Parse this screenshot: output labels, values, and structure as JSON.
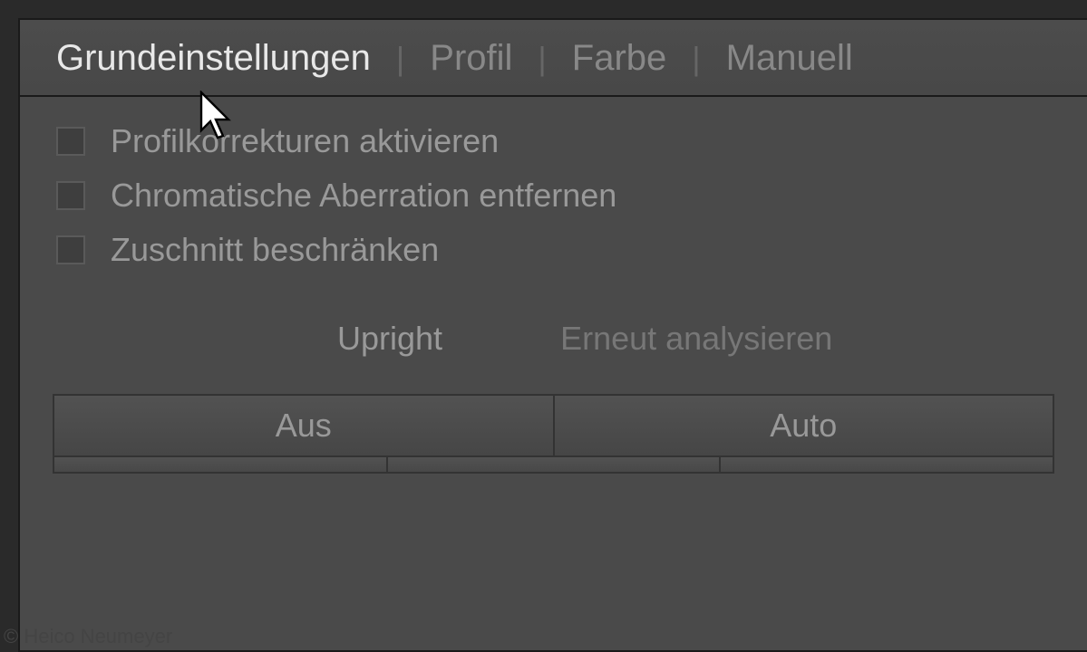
{
  "tabs": {
    "items": [
      {
        "label": "Grundeinstellungen",
        "active": true
      },
      {
        "label": "Profil",
        "active": false
      },
      {
        "label": "Farbe",
        "active": false
      },
      {
        "label": "Manuell",
        "active": false
      }
    ]
  },
  "checkboxes": {
    "items": [
      {
        "label": "Profilkorrekturen aktivieren",
        "checked": false
      },
      {
        "label": "Chromatische Aberration entfernen",
        "checked": false
      },
      {
        "label": "Zuschnitt beschränken",
        "checked": false
      }
    ]
  },
  "upright": {
    "label": "Upright",
    "reanalyze": "Erneut analysieren"
  },
  "modeButtons": {
    "items": [
      {
        "label": "Aus"
      },
      {
        "label": "Auto"
      }
    ]
  },
  "copyright": "© Heico Neumeyer"
}
